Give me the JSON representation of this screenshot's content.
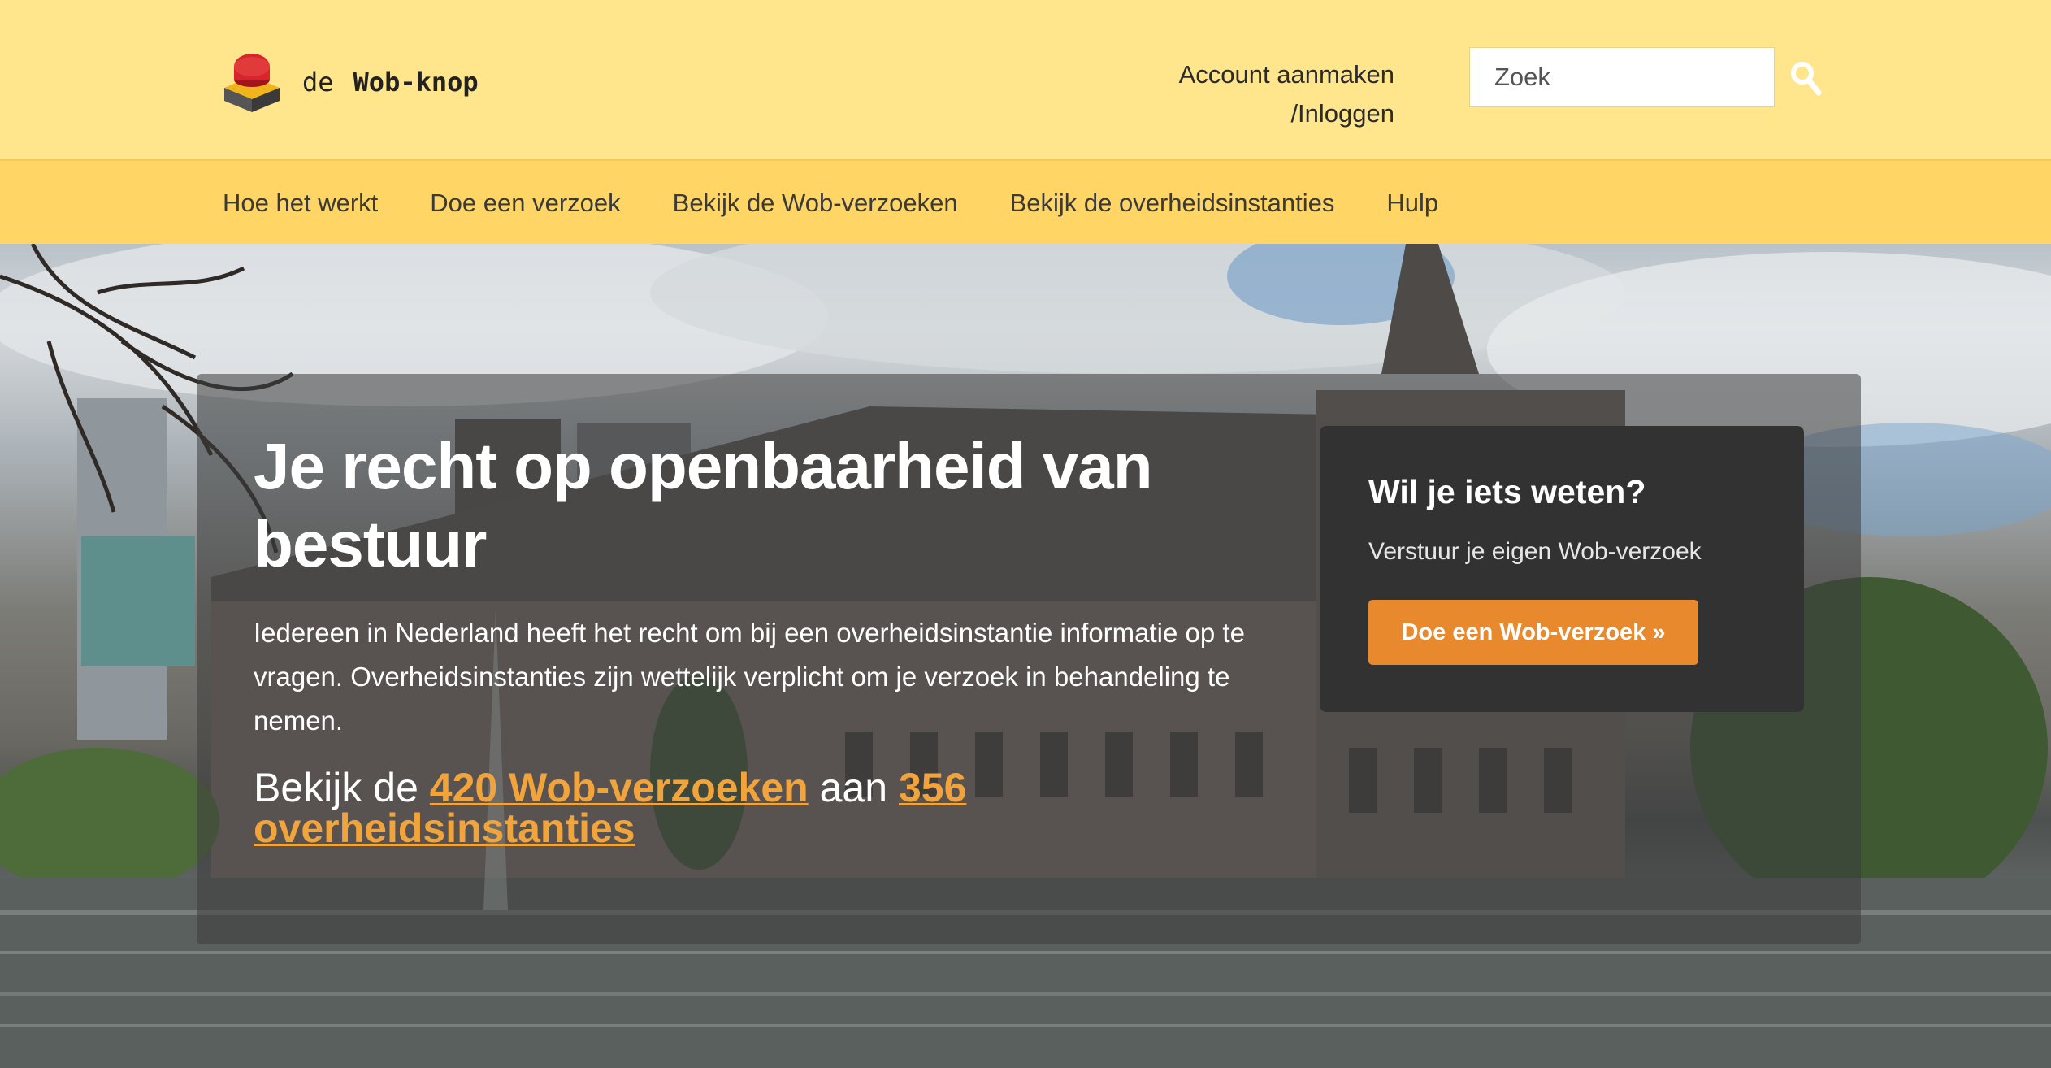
{
  "brand": {
    "prefix": "de",
    "name": "Wob-knop"
  },
  "account": {
    "line1": "Account aanmaken",
    "line2": "/Inloggen"
  },
  "search": {
    "placeholder": "Zoek",
    "icon": "search-icon"
  },
  "nav": {
    "items": [
      {
        "label": "Hoe het werkt"
      },
      {
        "label": "Doe een verzoek"
      },
      {
        "label": "Bekijk de Wob-verzoeken"
      },
      {
        "label": "Bekijk de overheidsinstanties"
      },
      {
        "label": "Hulp"
      }
    ]
  },
  "hero": {
    "title": "Je recht op openbaarheid van bestuur",
    "text": "Iedereen in Nederland heeft het recht om bij een overheidsinstantie informatie op te vragen. Overheidsinstanties zijn wettelijk verplicht om je verzoek in behandeling te nemen.",
    "stats": {
      "prefix": "Bekijk de",
      "requests_link": "420 Wob-verzoeken",
      "middle": "aan",
      "authorities_link": "356 overheidsinstanties"
    }
  },
  "cta": {
    "title": "Wil je iets weten?",
    "subtitle": "Verstuur je eigen Wob-verzoek",
    "button": "Doe een Wob-verzoek »"
  },
  "colors": {
    "header_bg": "#ffe58c",
    "nav_bg": "#ffd665",
    "accent": "#e8892d",
    "link": "#f2a43c",
    "cta_bg": "#333232"
  }
}
